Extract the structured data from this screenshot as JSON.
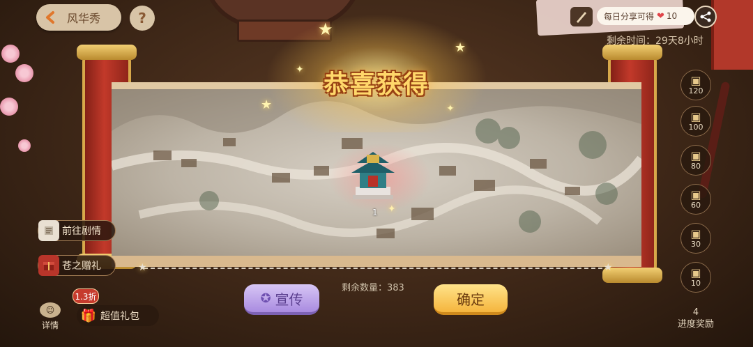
{
  "header": {
    "back_label": "风华秀",
    "help_label": "?"
  },
  "share": {
    "text": "每日分享可得",
    "reward_icon": "heart-icon",
    "reward_amount": "10"
  },
  "remaining_time": "剩余时间：29天8小时",
  "popup": {
    "title": "恭喜获得",
    "item_count": "1",
    "remaining_quantity": "剩余数量：383",
    "promote_label": "宣传",
    "confirm_label": "确定"
  },
  "side_menu": {
    "story_label": "前往剧情",
    "gift_label": "苍之赠礼",
    "detail_label": "详情",
    "discount_badge": "1.3折",
    "value_pack_label": "超值礼包"
  },
  "progress": {
    "milestones": [
      "120",
      "100",
      "80",
      "60",
      "30",
      "10"
    ],
    "current": "4",
    "label": "进度奖励"
  },
  "colors": {
    "accent_gold": "#ffd76a",
    "promote_purple": "#a98be0",
    "confirm_orange": "#f5b53d",
    "scroll_red": "#c2392a"
  }
}
